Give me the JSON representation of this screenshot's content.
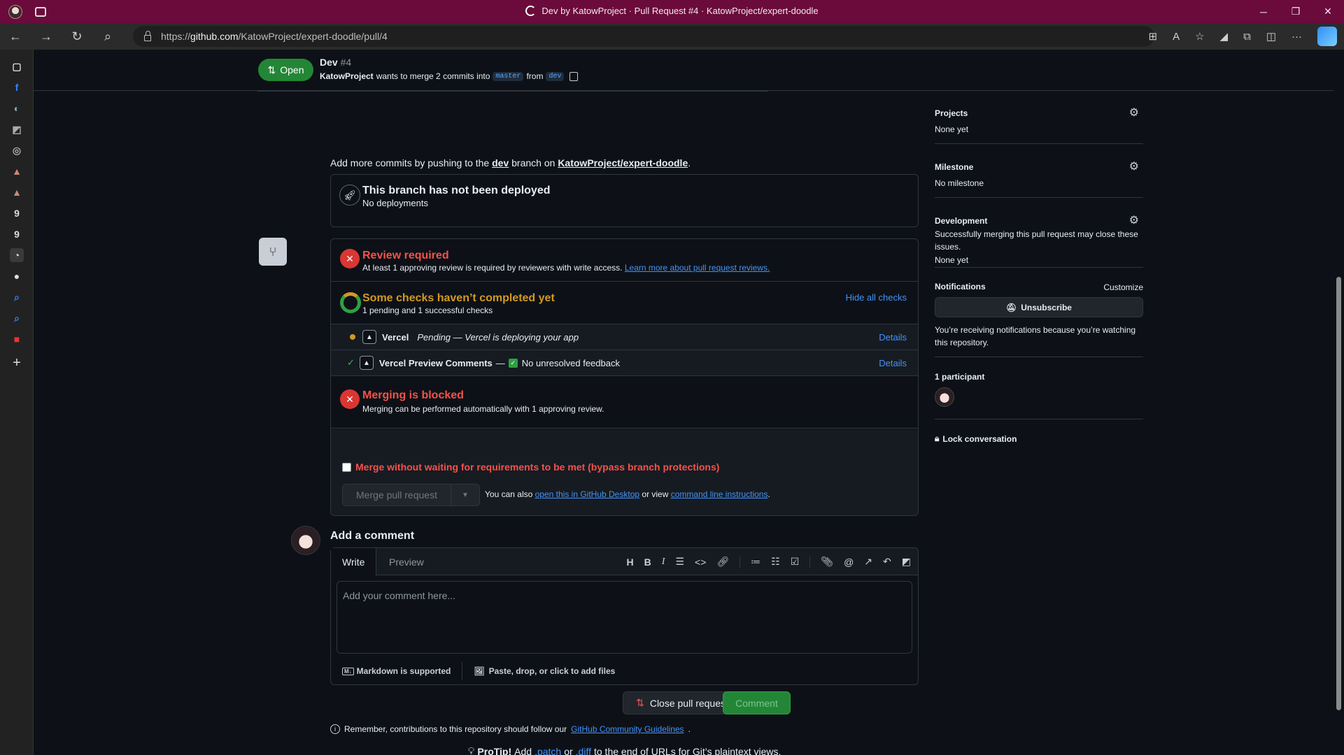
{
  "browser": {
    "title": "Dev by KatowProject · Pull Request #4 · KatowProject/expert-doodle",
    "url_prefix": "https://",
    "url_host": "github.com",
    "url_path": "/KatowProject/expert-doodle/pull/4"
  },
  "header": {
    "state": "Open",
    "title": "Dev",
    "number": "#4",
    "author": "KatowProject",
    "merge_text": "wants to merge 2 commits into",
    "base_branch": "master",
    "from_text": "from",
    "head_branch": "dev"
  },
  "hint": {
    "prefix": "Add more commits by pushing to the",
    "branch": "dev",
    "middle": "branch on",
    "repo": "KatowProject/expert-doodle",
    "suffix": "."
  },
  "deploy": {
    "title": "This branch has not been deployed",
    "subtitle": "No deployments"
  },
  "review": {
    "title": "Review required",
    "text": "At least 1 approving review is required by reviewers with write access.",
    "link": "Learn more about pull request reviews."
  },
  "checks": {
    "title": "Some checks haven’t completed yet",
    "subtitle": "1 pending and 1 successful checks",
    "toggle": "Hide all checks",
    "items": [
      {
        "name": "Vercel",
        "status": "Pending — Vercel is deploying your app",
        "details": "Details"
      },
      {
        "name": "Vercel Preview Comments",
        "sep": "—",
        "status": "No unresolved feedback",
        "details": "Details"
      }
    ]
  },
  "blocked": {
    "title": "Merging is blocked",
    "text": "Merging can be performed automatically with 1 approving review."
  },
  "merge": {
    "bypass_label": "Merge without waiting for requirements to be met (bypass branch protections)",
    "button": "Merge pull request",
    "alt_prefix": "You can also",
    "alt_link1": "open this in GitHub Desktop",
    "alt_mid": "or view",
    "alt_link2": "command line instructions",
    "alt_suffix": "."
  },
  "comment": {
    "heading": "Add a comment",
    "tab_write": "Write",
    "tab_preview": "Preview",
    "placeholder": "Add your comment here...",
    "markdown": "Markdown is supported",
    "attach": "Paste, drop, or click to add files",
    "close_button": "Close pull request",
    "submit_button": "Comment"
  },
  "footer": {
    "remember_prefix": "Remember, contributions to this repository should follow our",
    "remember_link": "GitHub Community Guidelines",
    "remember_suffix": ".",
    "protip_label": "ProTip!",
    "protip_add": "Add",
    "protip_patch": ".patch",
    "protip_or": "or",
    "protip_diff": ".diff",
    "protip_suffix": "to the end of URLs for Git’s plaintext views."
  },
  "sidebar": {
    "projects_label": "Projects",
    "projects_value": "None yet",
    "milestone_label": "Milestone",
    "milestone_value": "No milestone",
    "development_label": "Development",
    "development_text": "Successfully merging this pull request may close these issues.",
    "development_value": "None yet",
    "notifications_label": "Notifications",
    "customize": "Customize",
    "unsubscribe": "Unsubscribe",
    "notifications_text": "You’re receiving notifications because you’re watching this repository.",
    "participants": "1 participant",
    "lock": "Lock conversation"
  },
  "colors": {
    "accent_green": "#238636",
    "danger": "#f85149",
    "pending": "#d29922",
    "link": "#4493f8",
    "browser_frame": "#6b0b3b"
  }
}
